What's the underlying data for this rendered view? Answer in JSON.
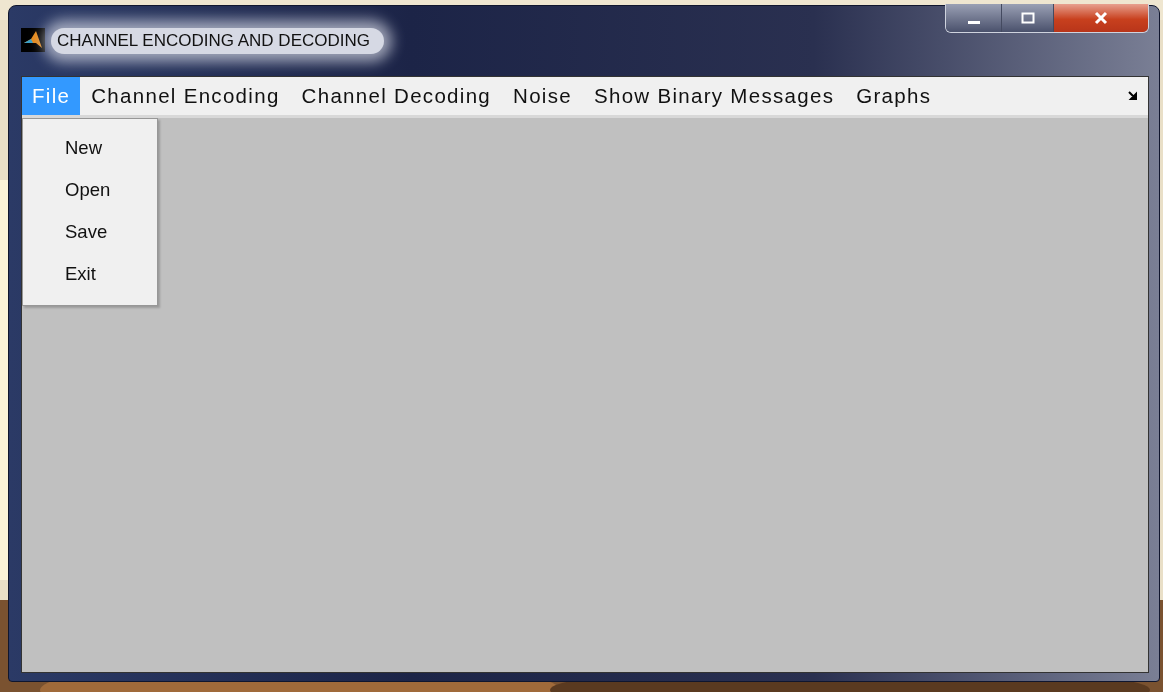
{
  "window": {
    "title": "CHANNEL ENCODING AND DECODING"
  },
  "menu": [
    {
      "label": "File",
      "selected": true
    },
    {
      "label": "Channel Encoding",
      "selected": false
    },
    {
      "label": "Channel Decoding",
      "selected": false
    },
    {
      "label": "Noise",
      "selected": false
    },
    {
      "label": "Show Binary Messages",
      "selected": false
    },
    {
      "label": "Graphs",
      "selected": false
    }
  ],
  "dropdown": {
    "items": [
      {
        "label": "New"
      },
      {
        "label": "Open"
      },
      {
        "label": "Save"
      },
      {
        "label": "Exit"
      }
    ]
  }
}
